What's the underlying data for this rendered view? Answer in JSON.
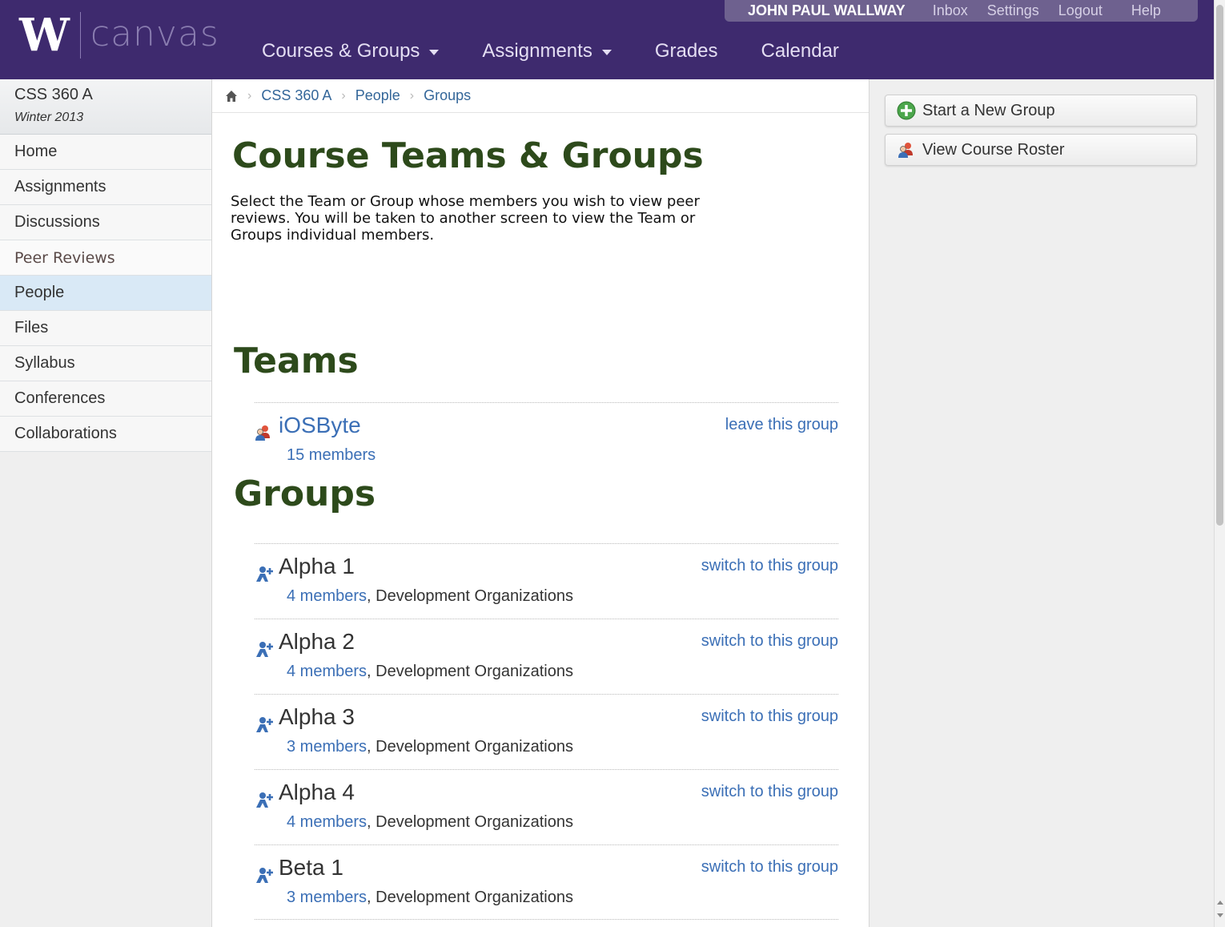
{
  "header": {
    "logo_letter": "W",
    "logo_text": "canvas",
    "user_name": "JOHN PAUL WALLWAY",
    "user_links": [
      "Inbox",
      "Settings",
      "Logout",
      "Help"
    ],
    "nav": [
      {
        "label": "Courses & Groups",
        "dropdown": true
      },
      {
        "label": "Assignments",
        "dropdown": true
      },
      {
        "label": "Grades",
        "dropdown": false
      },
      {
        "label": "Calendar",
        "dropdown": false
      }
    ],
    "colors": {
      "bar": "#3e2a6e",
      "user_menu": "#6e618f"
    }
  },
  "sidebar": {
    "course_name": "CSS 360 A",
    "course_term": "Winter 2013",
    "items": [
      {
        "label": "Home"
      },
      {
        "label": "Assignments"
      },
      {
        "label": "Discussions"
      },
      {
        "label": "Peer Reviews"
      },
      {
        "label": "People",
        "active": true
      },
      {
        "label": "Files"
      },
      {
        "label": "Syllabus"
      },
      {
        "label": "Conferences"
      },
      {
        "label": "Collaborations"
      }
    ]
  },
  "breadcrumb": {
    "icon": "home-icon",
    "items": [
      "CSS 360 A",
      "People",
      "Groups"
    ]
  },
  "main": {
    "title": "Course Teams & Groups",
    "intro_lines": [
      "Select the Team or Group whose members you wish to view peer",
      "reviews. You will be taken to another screen to view the Team or",
      "Groups individual members."
    ],
    "teams_heading": "Teams",
    "groups_heading": "Groups",
    "teams": [
      {
        "name": "iOSByte",
        "members": "15 members",
        "category": "",
        "action": "leave this group",
        "icon": "team-icon"
      }
    ],
    "groups": [
      {
        "name": "Alpha 1",
        "members": "4 members",
        "category": ", Development Organizations",
        "action": "switch to this group",
        "icon": "add-group-icon"
      },
      {
        "name": "Alpha 2",
        "members": "4 members",
        "category": ", Development Organizations",
        "action": "switch to this group",
        "icon": "add-group-icon"
      },
      {
        "name": "Alpha 3",
        "members": "3 members",
        "category": ", Development Organizations",
        "action": "switch to this group",
        "icon": "add-group-icon"
      },
      {
        "name": "Alpha 4",
        "members": "4 members",
        "category": ", Development Organizations",
        "action": "switch to this group",
        "icon": "add-group-icon"
      },
      {
        "name": "Beta 1",
        "members": "3 members",
        "category": ", Development Organizations",
        "action": "switch to this group",
        "icon": "add-group-icon"
      }
    ]
  },
  "right": {
    "start_group": {
      "label": "Start a New Group",
      "icon": "plus-circle-icon"
    },
    "view_roster": {
      "label": "View Course Roster",
      "icon": "people-icon"
    }
  }
}
